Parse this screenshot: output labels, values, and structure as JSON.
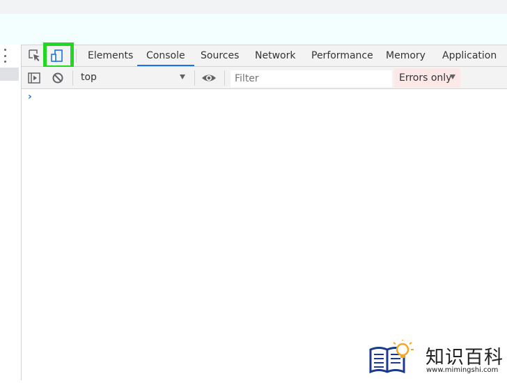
{
  "devtools": {
    "tabs": [
      {
        "label": "Elements"
      },
      {
        "label": "Console"
      },
      {
        "label": "Sources"
      },
      {
        "label": "Network"
      },
      {
        "label": "Performance"
      },
      {
        "label": "Memory"
      },
      {
        "label": "Application"
      }
    ],
    "active_tab": "Console",
    "highlight_color": "#22d622",
    "accent_color": "#1a73e8",
    "icons": {
      "inspect": "inspect-element-icon",
      "device": "device-toolbar-icon",
      "sidebar": "show-console-sidebar-icon",
      "clear": "clear-console-icon",
      "eye": "live-expression-eye-icon",
      "menu": "kebab-menu-icon"
    }
  },
  "console_toolbar": {
    "context": "top",
    "filter_placeholder": "Filter",
    "levels": "Errors only"
  },
  "console": {
    "prompt": "›"
  },
  "watermark": {
    "title": "知识百科",
    "url": "www.mimingshi.com"
  }
}
